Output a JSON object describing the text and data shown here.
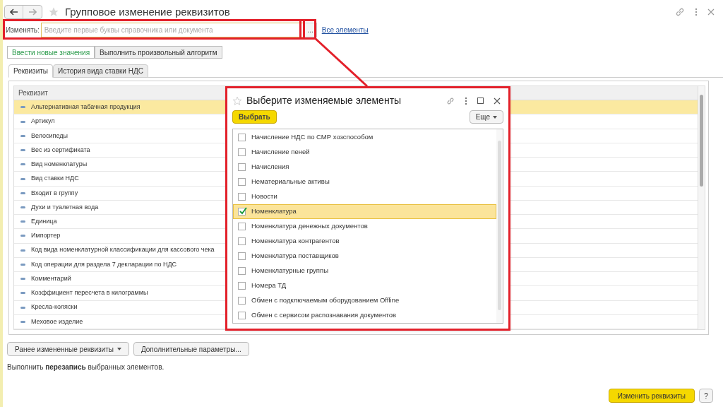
{
  "window": {
    "title": "Групповое изменение реквизитов"
  },
  "change_field": {
    "label": "Изменять:",
    "placeholder": "Введите первые буквы справочника или документа",
    "select_button": "...",
    "all_link": "Все элементы"
  },
  "mode_tabs": [
    {
      "label": "Ввести новые значения",
      "selected": true
    },
    {
      "label": "Выполнить произвольный алгоритм",
      "selected": false
    }
  ],
  "tabs": [
    {
      "label": "Реквизиты",
      "selected": true
    },
    {
      "label": "История вида ставки НДС",
      "selected": false
    }
  ],
  "table": {
    "columns": [
      "Реквизит"
    ],
    "rows": [
      {
        "name": "Альтернативная табачная продукция",
        "selected": true
      },
      {
        "name": "Артикул",
        "selected": false
      },
      {
        "name": "Велосипеды",
        "selected": false
      },
      {
        "name": "Вес из сертификата",
        "selected": false
      },
      {
        "name": "Вид номенклатуры",
        "selected": false
      },
      {
        "name": "Вид ставки НДС",
        "selected": false
      },
      {
        "name": "Входит в группу",
        "selected": false
      },
      {
        "name": "Духи и туалетная вода",
        "selected": false
      },
      {
        "name": "Единица",
        "selected": false
      },
      {
        "name": "Импортер",
        "selected": false
      },
      {
        "name": "Код вида номенклатурной классификации для кассового чека",
        "selected": false
      },
      {
        "name": "Код операции для раздела 7 декларации по НДС",
        "selected": false
      },
      {
        "name": "Комментарий",
        "selected": false
      },
      {
        "name": "Коэффициент пересчета в килограммы",
        "selected": false
      },
      {
        "name": "Кресла-коляски",
        "selected": false
      },
      {
        "name": "Меховое изделие",
        "selected": false
      }
    ]
  },
  "dialog": {
    "title": "Выберите изменяемые элементы",
    "choose_button": "Выбрать",
    "more_button": "Еще",
    "items": [
      {
        "label": "Начисление НДС по СМР хозспособом",
        "checked": false,
        "selected": false
      },
      {
        "label": "Начисление пеней",
        "checked": false,
        "selected": false
      },
      {
        "label": "Начисления",
        "checked": false,
        "selected": false
      },
      {
        "label": "Нематериальные активы",
        "checked": false,
        "selected": false
      },
      {
        "label": "Новости",
        "checked": false,
        "selected": false
      },
      {
        "label": "Номенклатура",
        "checked": true,
        "selected": true
      },
      {
        "label": "Номенклатура денежных документов",
        "checked": false,
        "selected": false
      },
      {
        "label": "Номенклатура контрагентов",
        "checked": false,
        "selected": false
      },
      {
        "label": "Номенклатура поставщиков",
        "checked": false,
        "selected": false
      },
      {
        "label": "Номенклатурные группы",
        "checked": false,
        "selected": false
      },
      {
        "label": "Номера ТД",
        "checked": false,
        "selected": false
      },
      {
        "label": "Обмен с подключаемым оборудованием Offline",
        "checked": false,
        "selected": false
      },
      {
        "label": "Обмен с сервисом распознавания документов",
        "checked": false,
        "selected": false
      }
    ]
  },
  "bottom_buttons": [
    {
      "label": "Ранее измененные реквизиты",
      "dropdown": true
    },
    {
      "label": "Дополнительные параметры...",
      "dropdown": false
    }
  ],
  "note": "Выполнить **перезапись** выбранных элементов.",
  "footer": {
    "apply_button": "Изменить реквизиты",
    "help_button": "?"
  }
}
